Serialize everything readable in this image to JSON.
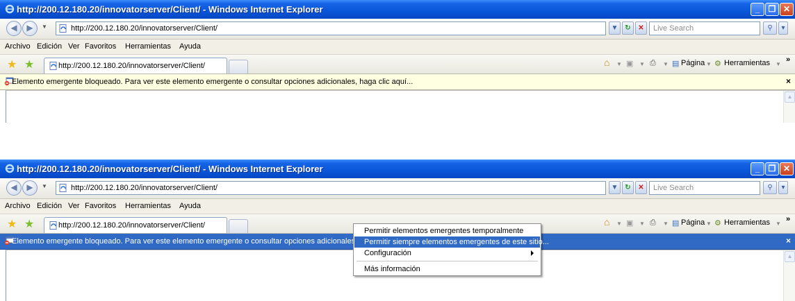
{
  "window_title": "http://200.12.180.20/innovatorserver/Client/ - Windows Internet Explorer",
  "address_url": "http://200.12.180.20/innovatorserver/Client/",
  "search_placeholder": "Live Search",
  "menu": [
    "Archivo",
    "Edición",
    "Ver",
    "Favoritos",
    "Herramientas",
    "Ayuda"
  ],
  "tab_title": "http://200.12.180.20/innovatorserver/Client/",
  "command_bar": {
    "page": "Página",
    "tools": "Herramientas",
    "chevron": "»"
  },
  "info_bar_message": "Elemento emergente bloqueado. Para ver este elemento emergente o consultar opciones adicionales, haga clic aquí...",
  "info_bar_close": "×",
  "context_menu": {
    "items": [
      "Permitir elementos emergentes temporalmente",
      "Permitir siempre elementos emergentes de este sitio...",
      "Configuración",
      "Más información"
    ],
    "highlighted_index": 1
  },
  "colors": {
    "titlebar": "#0a56d8",
    "info_bar": "#ffffe1",
    "selection": "#316ac5"
  }
}
